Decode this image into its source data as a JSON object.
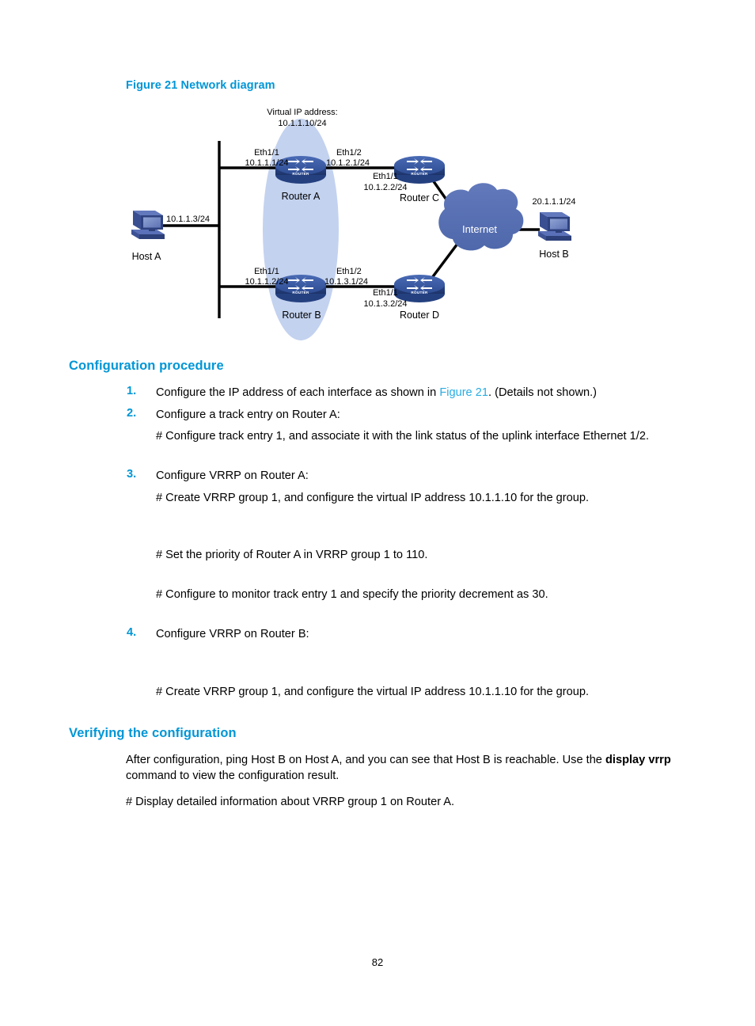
{
  "figure": {
    "caption": "Figure 21 Network diagram",
    "virtual_ip_label_line1": "Virtual IP address:",
    "virtual_ip_label_line2": "10.1.1.10/24",
    "nodes": {
      "host_a": {
        "name": "Host A",
        "ip": "10.1.1.3/24"
      },
      "host_b": {
        "name": "Host B",
        "ip": "20.1.1.1/24"
      },
      "router_a": {
        "name": "Router A",
        "left_if": "Eth1/1",
        "left_ip": "10.1.1.1/24",
        "right_if": "Eth1/2",
        "right_ip": "10.1.2.1/24"
      },
      "router_b": {
        "name": "Router B",
        "left_if": "Eth1/1",
        "left_ip": "10.1.1.2/24",
        "right_if": "Eth1/2",
        "right_ip": "10.1.3.1/24"
      },
      "router_c": {
        "name": "Router C",
        "left_if": "Eth1/1",
        "left_ip": "10.1.2.2/24"
      },
      "router_d": {
        "name": "Router D",
        "left_if": "Eth1/1",
        "left_ip": "10.1.3.2/24"
      },
      "cloud": {
        "name": "Internet"
      }
    },
    "colors": {
      "router_fill": "#3b5ba5",
      "router_fill_dark": "#2a4480",
      "cloud_fill": "#5771b4",
      "ellipse_fill": "#c4d3ef",
      "host_fill": "#4a5fa5",
      "link_line": "#000000"
    }
  },
  "sections": {
    "config_procedure": {
      "heading": "Configuration procedure",
      "steps": [
        {
          "num": "1.",
          "text_before_link": "Configure the IP address of each interface as shown in ",
          "link": "Figure 21",
          "text_after_link": ". (Details not shown.)"
        },
        {
          "num": "2.",
          "text": "Configure a track entry on Router A:"
        },
        {
          "num": "3.",
          "text": "Configure VRRP on Router A:"
        },
        {
          "num": "4.",
          "text": "Configure VRRP on Router B:"
        }
      ],
      "body_lines": {
        "step2_note": "# Configure track entry 1, and associate it with the link status of the uplink interface Ethernet 1/2.",
        "step3_note1": "# Create VRRP group 1, and configure the virtual IP address 10.1.1.10 for the group.",
        "step3_note2": "# Set the priority of Router A in VRRP group 1 to 110.",
        "step3_note3": "# Configure to monitor track entry 1 and specify the priority decrement as 30.",
        "step4_note1": "# Create VRRP group 1, and configure the virtual IP address 10.1.1.10 for the group."
      }
    },
    "verifying": {
      "heading": "Verifying the configuration",
      "para_part1": "After configuration, ping Host B on Host A, and you can see that Host B is reachable. Use the ",
      "para_bold1": "display",
      "para_bold2": "vrrp",
      "para_part2": " command to view the configuration result.",
      "para2": "# Display detailed information about VRRP group 1 on Router A."
    }
  },
  "footer": {
    "page_number": "82"
  }
}
